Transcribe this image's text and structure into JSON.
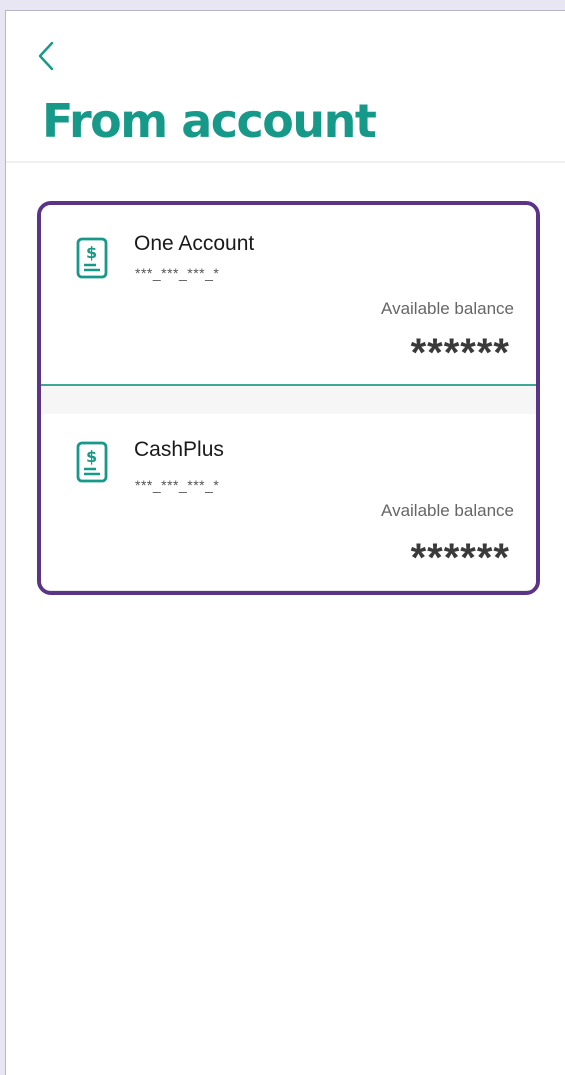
{
  "header": {
    "back_icon": "chevron-left-icon",
    "title": "From account"
  },
  "accounts": [
    {
      "icon": "receipt-dollar-icon",
      "name": "One Account",
      "number": "***_***_***_*",
      "balance_label": "Available balance",
      "balance": "******"
    },
    {
      "icon": "receipt-dollar-icon",
      "name": "CashPlus",
      "number": "***_***_***_*",
      "balance_label": "Available balance",
      "balance": "******"
    }
  ],
  "colors": {
    "accent": "#17998a",
    "highlight_border": "#5c3487",
    "text": "#1a1a1a"
  }
}
